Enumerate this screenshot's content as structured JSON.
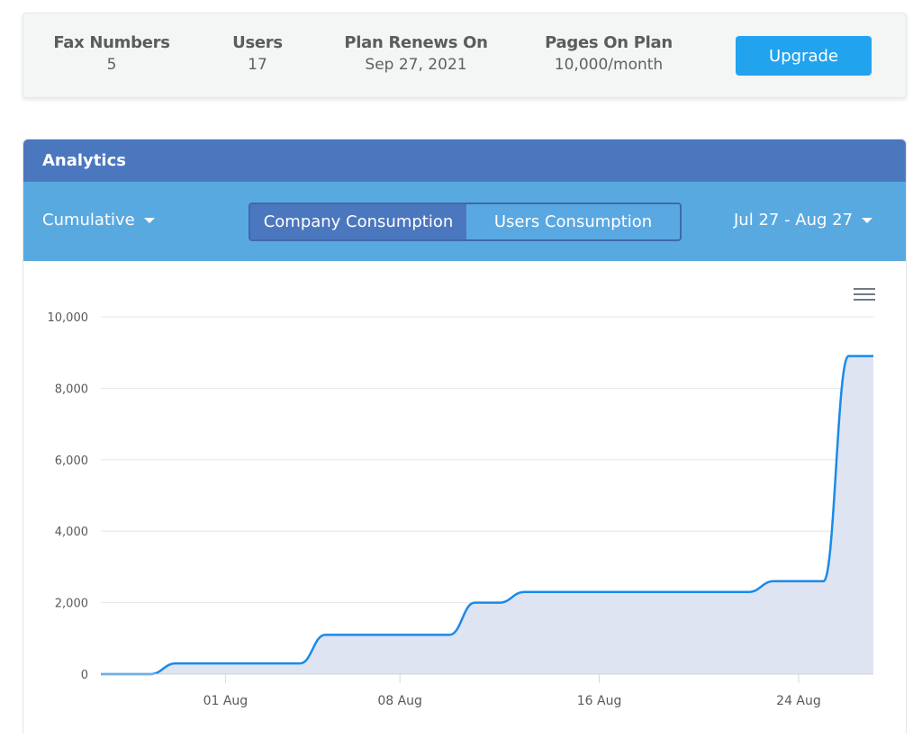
{
  "summary": {
    "stats": [
      {
        "label": "Fax Numbers",
        "value": "5"
      },
      {
        "label": "Users",
        "value": "17"
      },
      {
        "label": "Plan Renews On",
        "value": "Sep 27, 2021"
      },
      {
        "label": "Pages On Plan",
        "value": "10,000/month"
      }
    ],
    "upgrade_label": "Upgrade"
  },
  "analytics": {
    "title": "Analytics",
    "mode_dropdown": "Cumulative",
    "tabs": [
      {
        "label": "Company Consumption",
        "active": true
      },
      {
        "label": "Users Consumption",
        "active": false
      }
    ],
    "date_range": "Jul 27 - Aug 27",
    "menu_icon": "hamburger-menu-icon"
  },
  "colors": {
    "header": "#4b77bf",
    "toolbar": "#59a9e1",
    "upgrade": "#22a3ee",
    "line": "#1a8ae8",
    "area": "#dce3f0"
  },
  "chart_data": {
    "type": "area",
    "title": "",
    "xlabel": "",
    "ylabel": "",
    "x_start": "Jul 27",
    "x_end": "Aug 27",
    "ylim": [
      0,
      10000
    ],
    "yticks": [
      0,
      2000,
      4000,
      6000,
      8000,
      10000
    ],
    "ytick_labels": [
      "0",
      "2,000",
      "4,000",
      "6,000",
      "8,000",
      "10,000"
    ],
    "xticks": [
      {
        "label": "01 Aug",
        "day": 5
      },
      {
        "label": "08 Aug",
        "day": 12
      },
      {
        "label": "16 Aug",
        "day": 20
      },
      {
        "label": "24 Aug",
        "day": 28
      }
    ],
    "grid": true,
    "legend": "none",
    "series": [
      {
        "name": "Company Consumption",
        "points": [
          {
            "day": 0,
            "date": "Jul 27",
            "value": 0
          },
          {
            "day": 2,
            "date": "Jul 29",
            "value": 0
          },
          {
            "day": 3,
            "date": "Jul 30",
            "value": 300
          },
          {
            "day": 8,
            "date": "Aug 04",
            "value": 300
          },
          {
            "day": 9,
            "date": "Aug 05",
            "value": 1100
          },
          {
            "day": 14,
            "date": "Aug 10",
            "value": 1100
          },
          {
            "day": 15,
            "date": "Aug 11",
            "value": 2000
          },
          {
            "day": 16,
            "date": "Aug 12",
            "value": 2000
          },
          {
            "day": 17,
            "date": "Aug 13",
            "value": 2300
          },
          {
            "day": 26,
            "date": "Aug 22",
            "value": 2300
          },
          {
            "day": 27,
            "date": "Aug 23",
            "value": 2600
          },
          {
            "day": 29,
            "date": "Aug 25",
            "value": 2600
          },
          {
            "day": 30,
            "date": "Aug 26",
            "value": 8900
          },
          {
            "day": 31,
            "date": "Aug 27",
            "value": 8900
          }
        ]
      }
    ]
  }
}
